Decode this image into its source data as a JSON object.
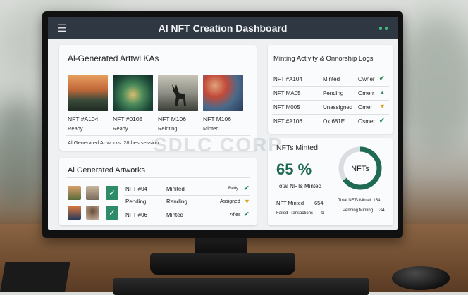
{
  "window": {
    "title": "AI NFT Creation Dashboard"
  },
  "gallery": {
    "title": "Al-Generated Arttwl KAs",
    "items": [
      {
        "name": "NFT #A104",
        "status": "Ready"
      },
      {
        "name": "NFT #0105",
        "status": "Ready"
      },
      {
        "name": "NFT M106",
        "status": "Reinting"
      },
      {
        "name": "NFT M106",
        "status": "Minted"
      }
    ],
    "footer": "Al Generated Artworks: 28 hes session"
  },
  "logs": {
    "title": "Minting Activity & Onnorship Logs",
    "rows": [
      {
        "id": "NFT #A104",
        "status": "Minted",
        "owner": "Owner"
      },
      {
        "id": "NFT MA05",
        "status": "Pending",
        "owner": "Omerr"
      },
      {
        "id": "NFT M005",
        "status": "Unassigned",
        "owner": "Omer"
      },
      {
        "id": "NFT #A106",
        "status": "Ox 681E",
        "owner": "Osmer"
      }
    ]
  },
  "artworks": {
    "title": "Al Generated Artworks",
    "rows": [
      {
        "col1": "NFT #04",
        "col2": "Minited",
        "col3": "Redy"
      },
      {
        "col1": "Pending",
        "col2": "Rending",
        "col3": "Assigned"
      },
      {
        "col1": "NFT #06",
        "col2": "Minted",
        "col3": "Afles"
      }
    ]
  },
  "stats": {
    "title": "NFTs Minted",
    "percent": "65 %",
    "percent_value": 0.65,
    "percent_label": "Total NFTs Minted",
    "donut_label": "NFTs",
    "left_rows": [
      {
        "label": "NFT Minted",
        "value": "654"
      },
      {
        "label": "Failed Transactions",
        "value": "5"
      }
    ],
    "right_rows": [
      {
        "label": "Total NFTs Mintel: 154"
      },
      {
        "label": "Pending Minting",
        "value": "34"
      }
    ]
  },
  "watermark": "SDLC CORP",
  "colors": {
    "topbar": "#2f3742",
    "accent_green": "#2e8b6a",
    "donut_track": "#d9dde2"
  }
}
